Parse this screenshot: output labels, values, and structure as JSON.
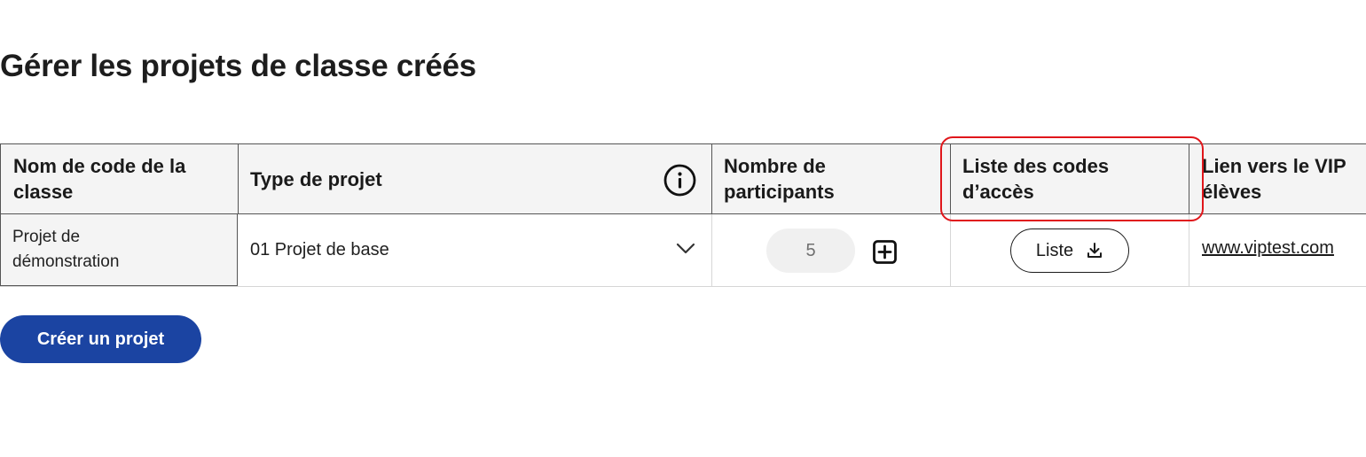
{
  "page": {
    "title": "Gérer les projets de classe créés"
  },
  "table": {
    "headers": {
      "class_code_line1": "Nom de code de la",
      "class_code_line2": "classe",
      "project_type": "Type de projet",
      "participants_line1": "Nombre de",
      "participants_line2": "participants",
      "access_codes_line1": "Liste des codes",
      "access_codes_line2": "d’accès",
      "vip_link_line1": "Lien vers le VIP",
      "vip_link_line2": "élèves"
    },
    "rows": [
      {
        "class_code_line1": "Projet de",
        "class_code_line2": "démonstration",
        "project_type": "01 Projet de base",
        "participants": "5",
        "access_codes_button": "Liste",
        "vip_link": "www.viptest.com"
      }
    ]
  },
  "actions": {
    "create_project": "Créer un projet"
  },
  "icons": {
    "info": "info-icon",
    "chevron": "chevron-down-icon",
    "plus": "plus-square-icon",
    "download": "download-icon"
  },
  "colors": {
    "primary_button": "#1b44a2",
    "highlight": "#e0161b",
    "header_background": "#f4f4f4"
  }
}
